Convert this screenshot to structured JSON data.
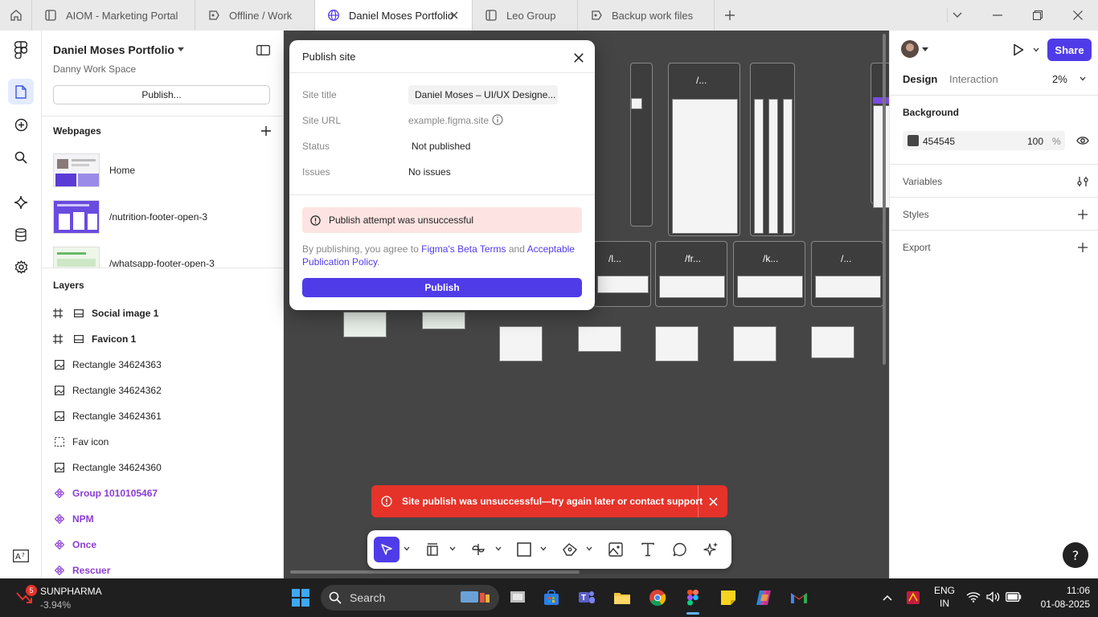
{
  "tabs": [
    {
      "label": "AIOM - Marketing Portal",
      "icon": "figma-file-icon"
    },
    {
      "label": "Offline / Work",
      "icon": "figma-slides-icon"
    },
    {
      "label": "Daniel Moses Portfolio",
      "icon": "globe-icon",
      "active": true
    },
    {
      "label": "Leo Group",
      "icon": "figjam-icon"
    },
    {
      "label": "Backup work files",
      "icon": "figma-slides-icon"
    }
  ],
  "left_panel": {
    "file_name": "Daniel Moses Portfolio",
    "workspace": "Danny Work Space",
    "publish_button": "Publish...",
    "webpages_title": "Webpages",
    "webpages": [
      {
        "label": "Home"
      },
      {
        "label": "/nutrition-footer-open-3"
      },
      {
        "label": "/whatsapp-footer-open-3"
      }
    ],
    "layers_title": "Layers",
    "layers": [
      {
        "label": "Social image 1",
        "type": "frame-image"
      },
      {
        "label": "Favicon 1",
        "type": "frame-image"
      },
      {
        "label": "Rectangle 34624363",
        "type": "image"
      },
      {
        "label": "Rectangle 34624362",
        "type": "image"
      },
      {
        "label": "Rectangle 34624361",
        "type": "image"
      },
      {
        "label": "Fav icon",
        "type": "dashed-frame"
      },
      {
        "label": "Rectangle 34624360",
        "type": "image"
      },
      {
        "label": "Group 1010105467",
        "type": "component"
      },
      {
        "label": "NPM",
        "type": "component"
      },
      {
        "label": "Once",
        "type": "component"
      },
      {
        "label": "Rescuer",
        "type": "component"
      }
    ]
  },
  "dialog": {
    "title": "Publish site",
    "site_title_label": "Site title",
    "site_title_value": "Daniel Moses – UI/UX Designe...",
    "site_url_label": "Site URL",
    "site_url_value": "example.figma.site",
    "status_label": "Status",
    "status_value": "Not published",
    "issues_label": "Issues",
    "issues_value": "No issues",
    "error_text": "Publish attempt was unsuccessful",
    "terms_prefix": "By publishing, you agree to ",
    "terms_link1": "Figma's Beta Terms",
    "terms_and": " and ",
    "terms_link2": "Acceptable Publication Policy",
    "terms_end": ".",
    "publish_button": "Publish"
  },
  "canvas": {
    "frame_labels": [
      "/...",
      "/l...",
      "/fr...",
      "/k...",
      "/..."
    ],
    "toast_text": "Site publish was unsuccessful—try again later or contact support"
  },
  "right_panel": {
    "tab_design": "Design",
    "tab_interaction": "Interaction",
    "zoom": "2%",
    "share_button": "Share",
    "background_title": "Background",
    "background_hex": "454545",
    "background_opacity": "100",
    "percent_sign": "%",
    "variables": "Variables",
    "styles": "Styles",
    "export": "Export"
  },
  "taskbar": {
    "stock_badge": "5",
    "stock_name": "SUNPHARMA",
    "stock_change": "-3.94%",
    "search_label": "Search",
    "lang_top": "ENG",
    "lang_bottom": "IN",
    "time": "11:06",
    "date": "01-08-2025"
  },
  "colors": {
    "accent": "#4f3ce8",
    "error_bg": "#fde4e2",
    "toast_red": "#e5332a",
    "canvas_bg": "#454545",
    "component_purple": "#8b3dd1"
  }
}
